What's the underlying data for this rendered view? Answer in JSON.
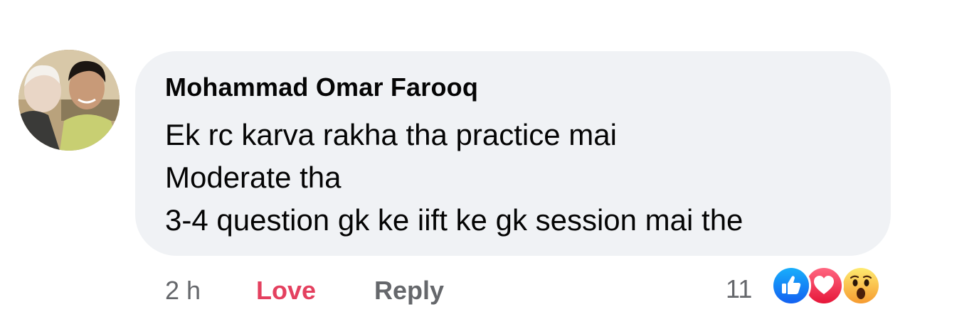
{
  "comment": {
    "author": "Mohammad Omar Farooq",
    "lines": [
      "Ek rc karva rakha tha practice mai",
      "Moderate tha",
      "3-4 question gk ke iift ke gk session mai the"
    ]
  },
  "actions": {
    "time": "2 h",
    "love_label": "Love",
    "reply_label": "Reply"
  },
  "reactions": {
    "count": "11",
    "types": [
      "like-icon",
      "love-icon",
      "wow-icon"
    ]
  },
  "colors": {
    "bubble": "#f0f2f5",
    "love": "#e4405f",
    "meta": "#65676b",
    "like": "#1877f2",
    "heart": "#f33e58",
    "wow": "#f7b125"
  }
}
